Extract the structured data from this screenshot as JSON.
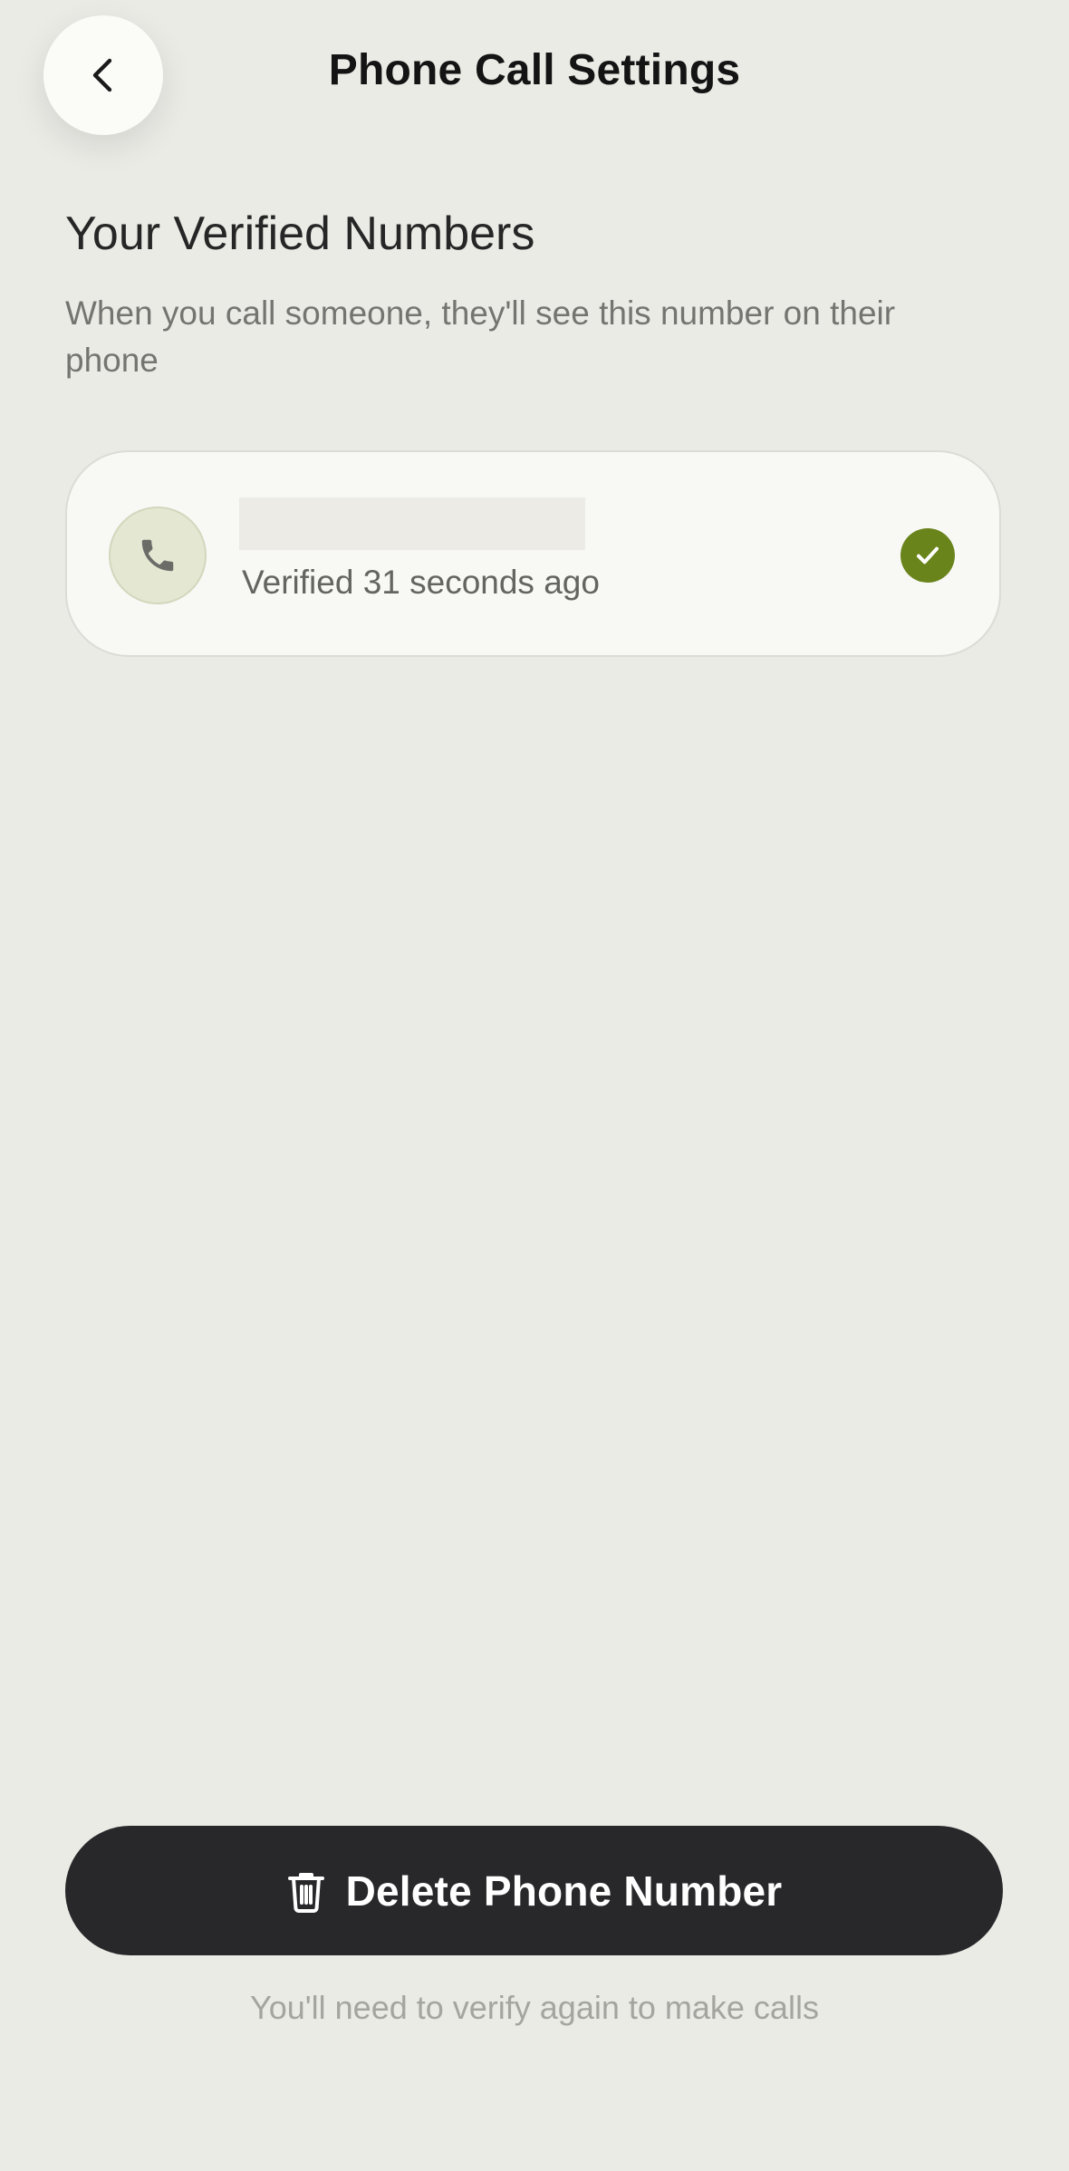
{
  "header": {
    "title": "Phone Call Settings",
    "back_icon": "chevron-left-icon"
  },
  "section": {
    "title": "Your Verified Numbers",
    "description": "When you call someone, they'll see this number on their phone"
  },
  "verified_number": {
    "icon": "phone-icon",
    "status_text": "Verified 31 seconds ago",
    "status_icon": "checkmark-icon",
    "status_color": "#6a841c"
  },
  "delete_button": {
    "icon": "trash-icon",
    "label": "Delete Phone Number"
  },
  "footer": {
    "note": "You'll need to verify again to make calls"
  },
  "colors": {
    "background": "#ebebe6",
    "card": "#f8f8f5",
    "primary_button": "#28272a",
    "accent_green": "#6a841c"
  }
}
